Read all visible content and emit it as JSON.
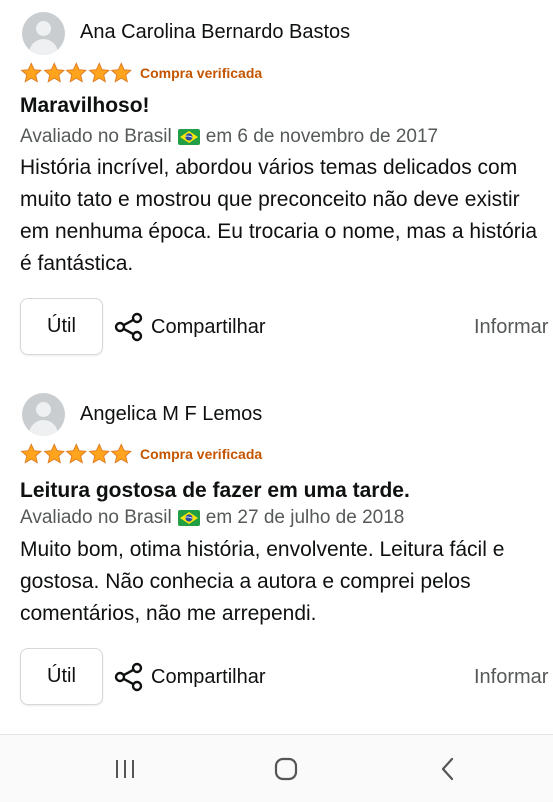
{
  "reviews": [
    {
      "author": "Ana Carolina Bernardo Bastos",
      "rating": 5,
      "verified_label": "Compra verificada",
      "title": "Maravilhoso!",
      "meta_prefix": "Avaliado no Brasil",
      "meta_suffix": "em 6 de novembro de 2017",
      "body": "História incrível, abordou vários temas delicados com muito tato e mostrou que preconceito não deve existir em nenhuma época. Eu trocaria o nome, mas a história é fantástica.",
      "helpful_label": "Útil",
      "share_label": "Compartilhar",
      "report_label": "Informar"
    },
    {
      "author": "Angelica M F Lemos",
      "rating": 5,
      "verified_label": "Compra verificada",
      "title": "Leitura gostosa de fazer em uma tarde.",
      "meta_prefix": "Avaliado no Brasil",
      "meta_suffix": "em 27 de julho de 2018",
      "body": "Muito bom, otima história, envolvente. Leitura fácil e gostosa. Não conhecia a autora e comprei pelos comentários, não me arrependi.",
      "helpful_label": "Útil",
      "share_label": "Compartilhar",
      "report_label": "Informar"
    }
  ],
  "colors": {
    "star": "#ffa41c",
    "verified": "#c45500",
    "meta": "#565959",
    "text": "#0f1111"
  },
  "icons": {
    "avatar": "user-silhouette-icon",
    "star": "star-icon",
    "flag": "brazil-flag-icon",
    "share": "share-icon",
    "nav_recents": "recent-apps-icon",
    "nav_home": "home-icon",
    "nav_back": "back-icon"
  }
}
